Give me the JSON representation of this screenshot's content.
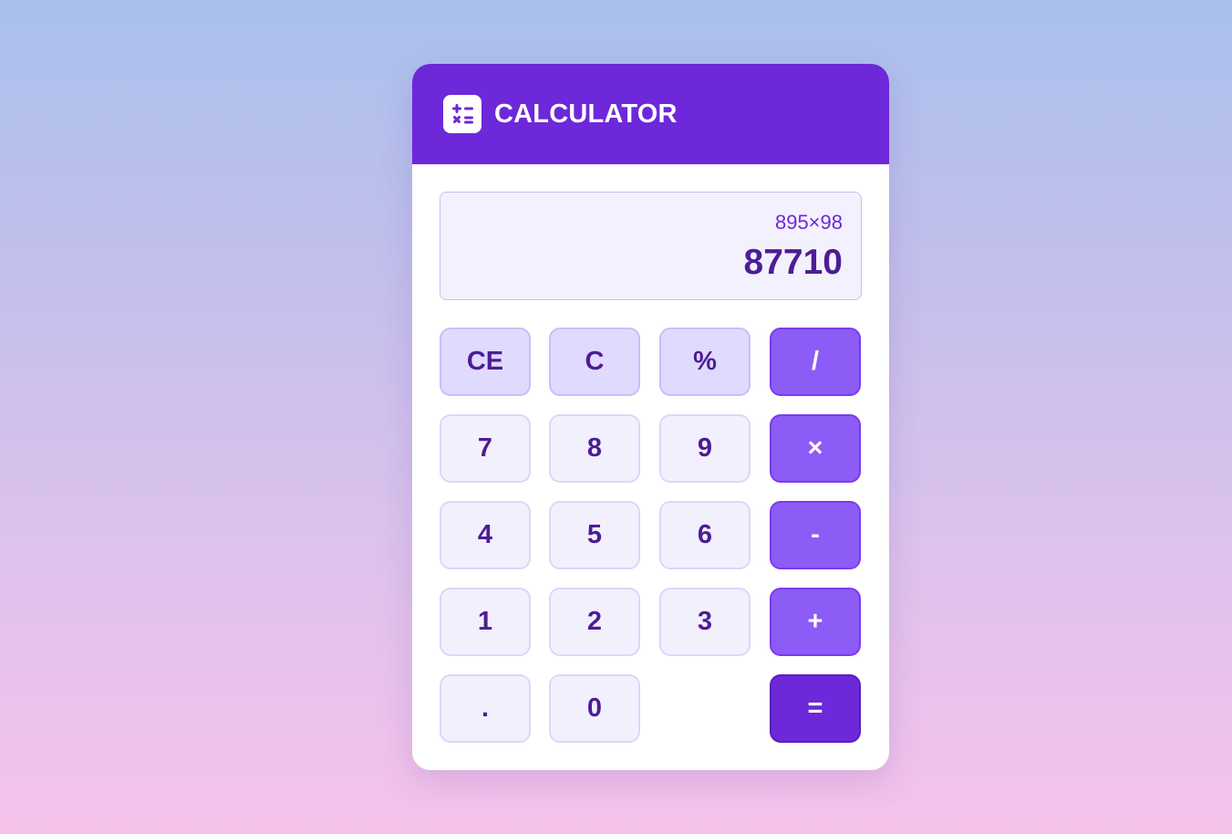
{
  "app": {
    "title": "CALCULATOR",
    "logo_icon": "calculator-icon"
  },
  "display": {
    "expression": "895×98",
    "result": "87710"
  },
  "keys": {
    "ce": "CE",
    "c": "C",
    "percent": "%",
    "divide": "/",
    "seven": "7",
    "eight": "8",
    "nine": "9",
    "multiply": "×",
    "four": "4",
    "five": "5",
    "six": "6",
    "minus": "-",
    "one": "1",
    "two": "2",
    "three": "3",
    "plus": "+",
    "dot": ".",
    "zero": "0",
    "equals": "="
  },
  "colors": {
    "header": "#6d28d9",
    "operator": "#8b5cf6",
    "equals": "#6d28d9",
    "function_key": "#e1daff",
    "digit_key": "#f3f0fd",
    "text_dark": "#4c1d95"
  }
}
